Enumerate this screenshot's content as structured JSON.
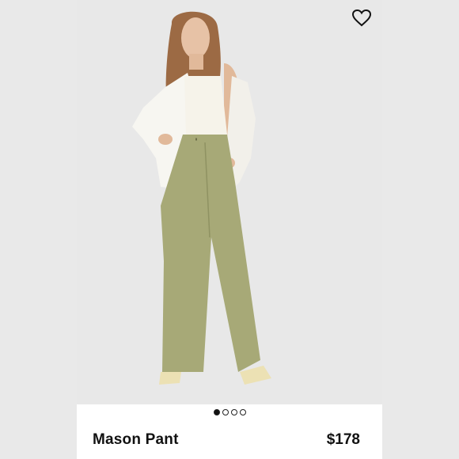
{
  "product": {
    "name": "Mason Pant",
    "price": "$178"
  },
  "carousel": {
    "total": 4,
    "active_index": 0
  },
  "icons": {
    "favorite": "heart-outline-icon"
  },
  "colors": {
    "background": "#ebebeb",
    "card": "#ffffff",
    "text": "#111111",
    "pant_olive": "#a7a977",
    "top_ivory": "#f6f3ea"
  }
}
